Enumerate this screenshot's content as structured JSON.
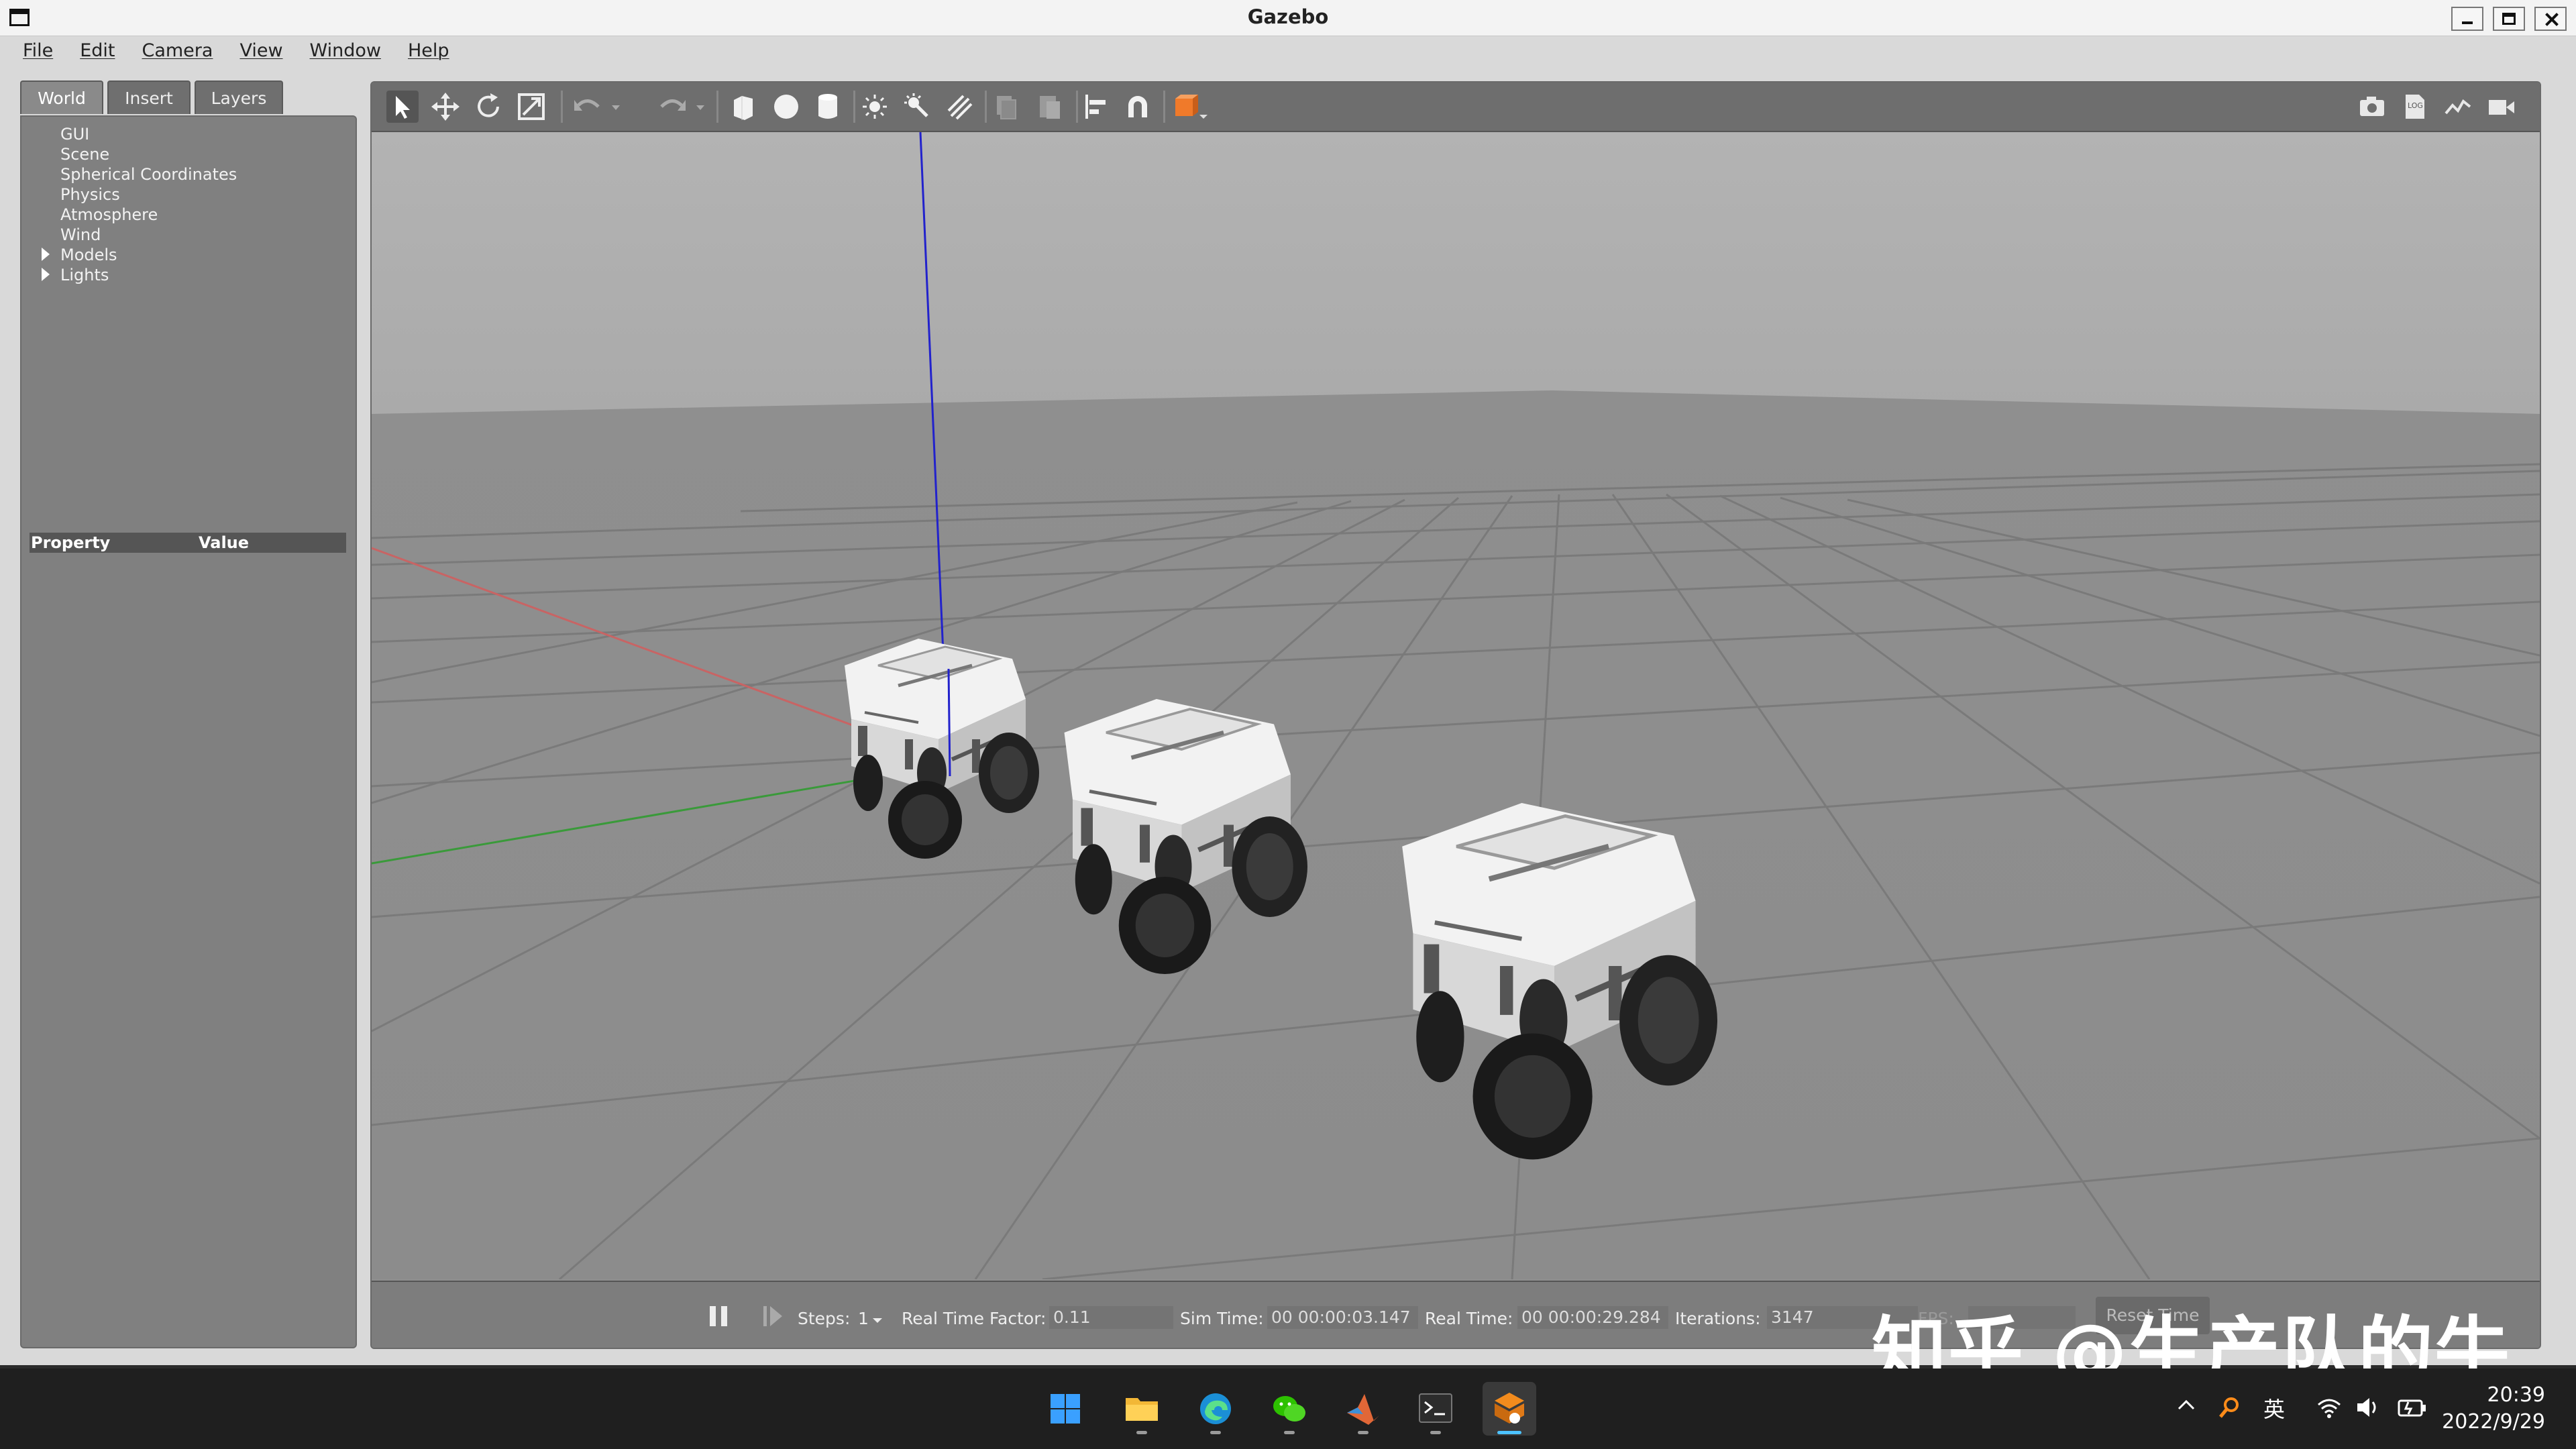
{
  "window": {
    "title": "Gazebo"
  },
  "menu": [
    "File",
    "Edit",
    "Camera",
    "View",
    "Window",
    "Help"
  ],
  "tabs": [
    "World",
    "Insert",
    "Layers"
  ],
  "tree": [
    "GUI",
    "Scene",
    "Spherical Coordinates",
    "Physics",
    "Atmosphere",
    "Wind",
    "Models",
    "Lights"
  ],
  "properties": {
    "col1": "Property",
    "col2": "Value"
  },
  "bottombar": {
    "steps_label": "Steps:",
    "steps_value": "1",
    "rtf_label": "Real Time Factor:",
    "rtf_value": "0.11",
    "sim_label": "Sim Time:",
    "sim_value": "00 00:00:03.147",
    "real_label": "Real Time:",
    "real_value": "00 00:00:29.284",
    "iter_label": "Iterations:",
    "iter_value": "3147",
    "fps_label": "FPS:",
    "reset_label": "Reset Time"
  },
  "watermark": "知乎 @生产队的牛",
  "taskbar": {
    "apps": [
      "windows-start-icon",
      "file-explorer-icon",
      "edge-browser-icon",
      "wechat-icon",
      "matlab-icon",
      "terminal-icon",
      "gazebo-icon"
    ],
    "ime": "英",
    "time": "20:39",
    "date": "2022/9/29"
  },
  "colors": {
    "x_axis": "#c86464",
    "y_axis": "#3a9a3a",
    "z_axis": "#2222cc",
    "accent": "#4cc2ff"
  }
}
